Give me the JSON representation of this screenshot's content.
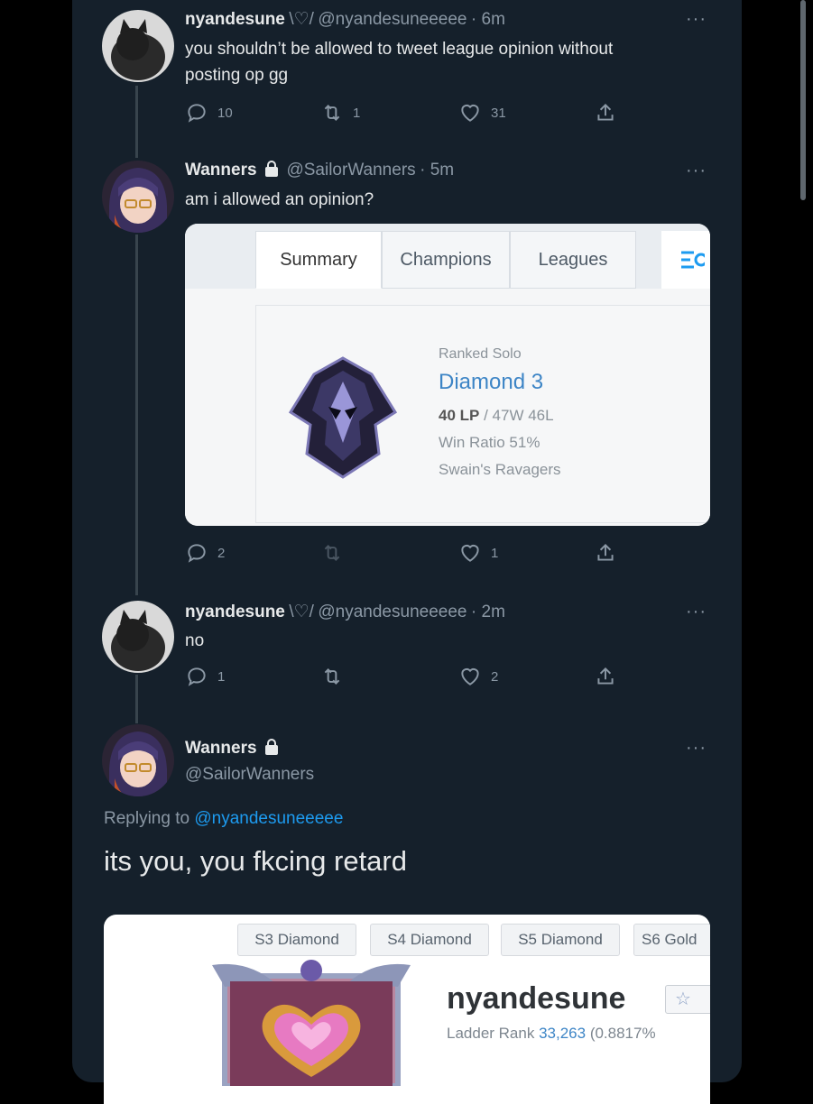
{
  "tweets": [
    {
      "name": "nyandesune",
      "emoji": "\\♡/",
      "handle": "@nyandesuneeeee",
      "time": "· 6m",
      "text_line1": "you shouldn’t be allowed to tweet league opinion without",
      "text_line2": "posting op gg",
      "replies": "10",
      "retweets": "1",
      "likes": "31"
    },
    {
      "name": "Wanners",
      "handle": "@SailorWanners",
      "time": "· 5m",
      "text": "am i allowed an opinion?",
      "replies": "2",
      "retweets": "",
      "likes": "1"
    },
    {
      "name": "nyandesune",
      "emoji": "\\♡/",
      "handle": "@nyandesuneeeee",
      "time": "· 2m",
      "text": "no",
      "replies": "1",
      "retweets": "",
      "likes": "2"
    }
  ],
  "main_tweet": {
    "name": "Wanners",
    "handle": "@SailorWanners",
    "replying_prefix": "Replying to",
    "replying_handle": "@nyandesuneeeee",
    "text": "its you, you fkcing retard"
  },
  "opgg_card": {
    "tabs": [
      "Summary",
      "Champions",
      "Leagues"
    ],
    "queue": "Ranked Solo",
    "tier": "Diamond 3",
    "lp": "40 LP",
    "record": " / 47W 46L",
    "win_ratio": "Win Ratio 51%",
    "league_name": "Swain's Ravagers"
  },
  "profile_card": {
    "seasons": [
      "S3 Diamond",
      "S4 Diamond",
      "S5 Diamond",
      "S6 Gold"
    ],
    "summoner": "nyandesune",
    "ladder_label": "Ladder Rank",
    "ladder_rank": "33,263",
    "ladder_percent": "(0.8817%"
  },
  "more_label": "···",
  "colors": {
    "background": "#15202b",
    "accent": "#1d9bf0",
    "tier_blue": "#3d85c6"
  }
}
